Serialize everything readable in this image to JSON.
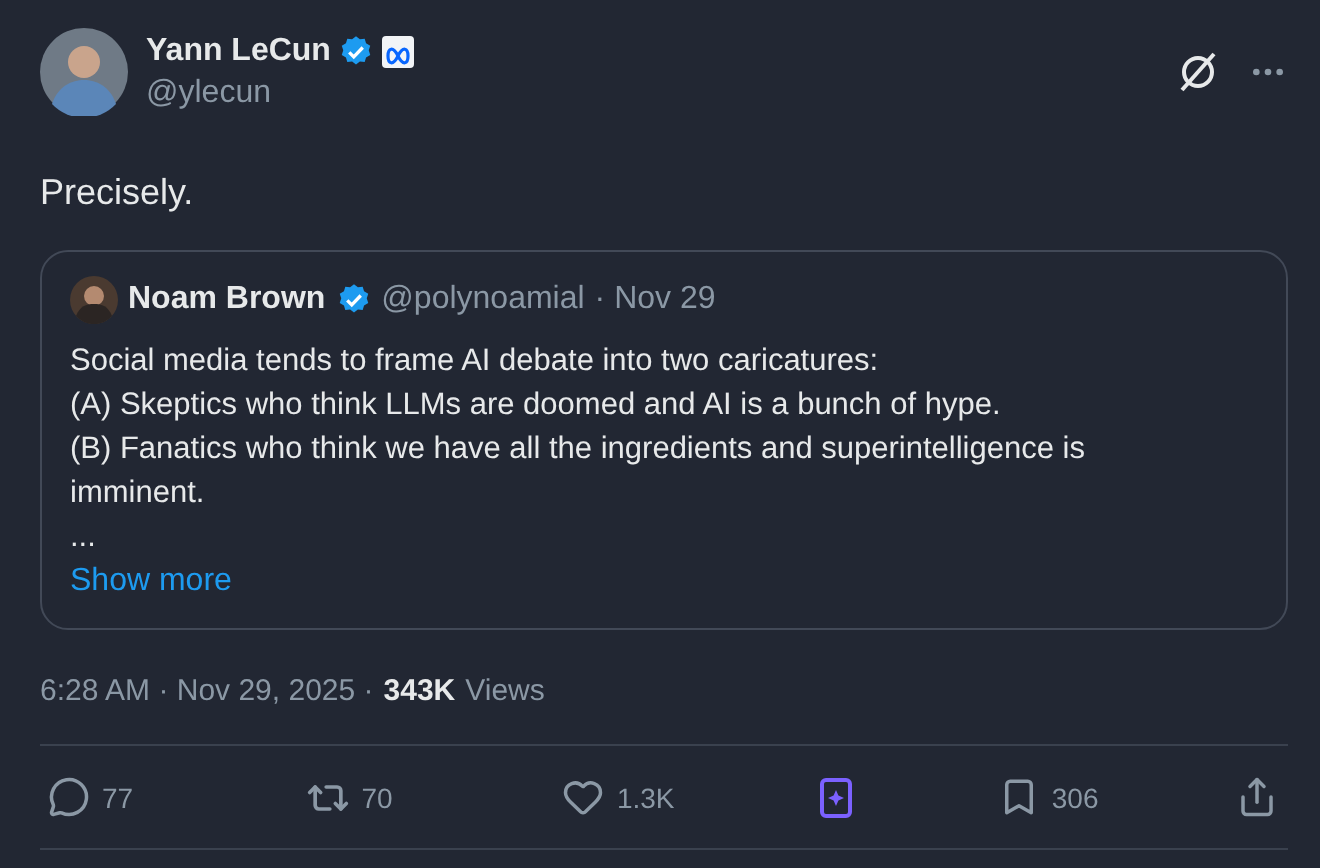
{
  "author": {
    "name": "Yann LeCun",
    "handle": "@ylecun",
    "verified": true
  },
  "text": "Precisely.",
  "quote": {
    "name": "Noam Brown",
    "verified": true,
    "handle": "@polynoamial",
    "date": "· Nov 29",
    "lines": [
      "Social media tends to frame AI debate into two caricatures:",
      "(A) Skeptics who think LLMs are doomed and AI is a bunch of hype.",
      "(B) Fanatics who think we have all the ingredients and superintelligence is imminent.",
      "..."
    ],
    "show_more": "Show more"
  },
  "meta": {
    "time": "6:28 AM · Nov 29, 2025 ·",
    "views": "343K",
    "views_label": "Views"
  },
  "actions": [
    {
      "kind": "reply",
      "count": "77"
    },
    {
      "kind": "repost",
      "count": "70"
    },
    {
      "kind": "like",
      "count": "1.3K"
    },
    {
      "kind": "grok"
    },
    {
      "kind": "bookmark",
      "count": "306"
    },
    {
      "kind": "share"
    }
  ]
}
